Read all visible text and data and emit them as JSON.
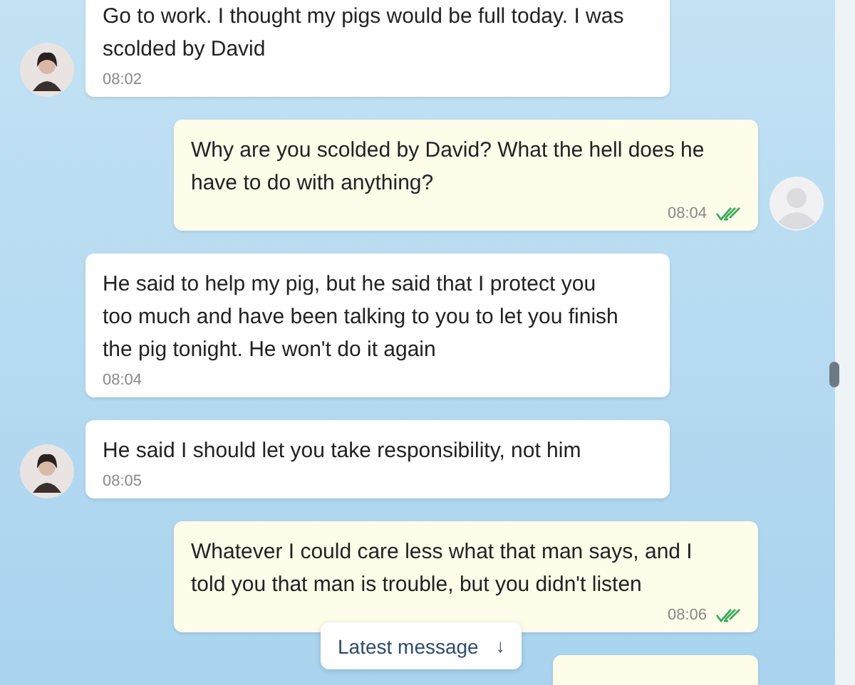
{
  "messages": [
    {
      "kind": "incoming",
      "text": "Go to work. I thought my pigs would be full today. I was scolded by David",
      "time": "08:02",
      "avatar": true
    },
    {
      "kind": "outgoing",
      "text": "Why are you scolded by David? What the hell does he have to do with anything?",
      "time": "08:04",
      "avatar": true,
      "read": true
    },
    {
      "kind": "incoming",
      "text": "He said to help my pig, but he said that I protect you too much and have been talking to you to let you finish the pig tonight. He won't do it again",
      "time": "08:04",
      "avatar": false
    },
    {
      "kind": "incoming",
      "text": "He said I should let you take responsibility, not him",
      "time": "08:05",
      "avatar": true
    },
    {
      "kind": "outgoing",
      "text": "Whatever I could care less what that man says, and I told you that man is trouble, but you didn't listen",
      "time": "08:06",
      "avatar": false,
      "read": true
    }
  ],
  "latest_button": {
    "label": "Latest message",
    "icon": "↓"
  }
}
